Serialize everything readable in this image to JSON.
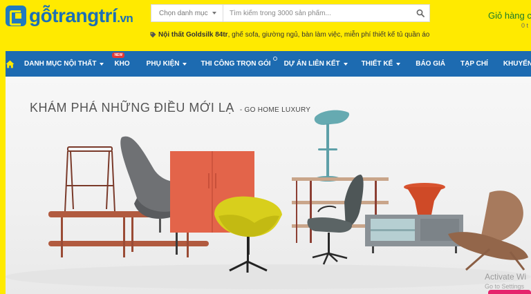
{
  "header": {
    "logo": {
      "text": "gỗtrangtrí",
      "suffix": ".vn"
    },
    "search": {
      "category_placeholder": "Chọn danh mục",
      "input_placeholder": "Tìm kiếm trong 3000 sản phẩm..."
    },
    "cart": {
      "label": "Giỏ hàng c",
      "count": "0 t"
    },
    "tags": {
      "highlight": "Nội thất Goldsilk 84tr",
      "rest": ", ghế sofa, giường ngủ, bàn làm việc, miễn phí thiết kế tủ quần áo"
    }
  },
  "nav": {
    "items": [
      {
        "label": "DANH MỤC NỘI THẤT"
      },
      {
        "label": "KHO",
        "badge": "NEW"
      },
      {
        "label": "PHỤ KIỆN"
      },
      {
        "label": "THI CÔNG TRỌN GÓI"
      },
      {
        "label": "DỰ ÁN LIÊN KẾT"
      },
      {
        "label": "THIẾT KẾ"
      },
      {
        "label": "BÁO GIÁ"
      },
      {
        "label": "TẠP CHÍ"
      },
      {
        "label": "KHUYẾN MÃ"
      }
    ]
  },
  "banner": {
    "headline": "KHÁM PHÁ NHỮNG ĐIỀU MỚI LẠ",
    "subheadline": "- GO HOME LUXURY"
  },
  "watermark": {
    "line1": "Activate Wi",
    "line2": "Go to Settings"
  },
  "colors": {
    "yellow": "#ffea00",
    "nav_blue": "#1d6bb1",
    "logo_blue": "#1b6fb6",
    "cart_green": "#1a7b2c"
  }
}
